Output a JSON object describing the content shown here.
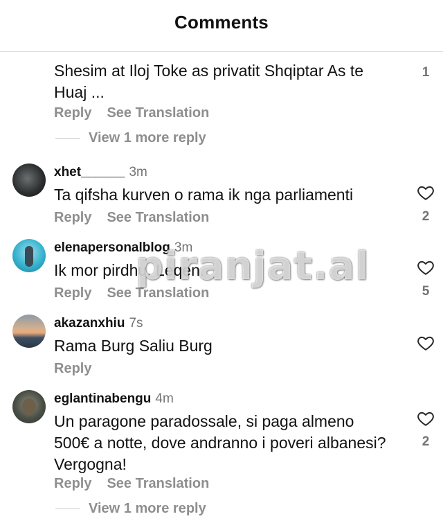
{
  "header": {
    "title": "Comments"
  },
  "top_comment": {
    "text": "Shesim at Iloj Toke as privatit Shqiptar As te Huaj ...",
    "count": "1",
    "reply_label": "Reply",
    "translate_label": "See Translation",
    "more_replies": "View 1 more reply"
  },
  "comments": [
    {
      "username": "xhet______",
      "time": "3m",
      "text": "Ta qifsha kurven o rama ik nga parliamenti",
      "likes": "2",
      "reply_label": "Reply",
      "translate_label": "See Translation"
    },
    {
      "username": "elenapersonalblog",
      "time": "3m",
      "text": "Ik mor pirdhu. Leqen.",
      "likes": "5",
      "reply_label": "Reply",
      "translate_label": "See Translation"
    },
    {
      "username": "akazanxhiu",
      "time": "7s",
      "text": "Rama Burg Saliu Burg",
      "likes": "",
      "reply_label": "Reply"
    },
    {
      "username": "eglantinabengu",
      "time": "4m",
      "text": "Un paragone paradossale, si paga almeno 500€ a notte, dove andranno i poveri albanesi? Vergogna!",
      "likes": "2",
      "reply_label": "Reply",
      "translate_label": "See Translation",
      "more_replies": "View 1 more reply"
    }
  ],
  "watermark": "piranjat.al",
  "icons": {
    "like": "heart-outline-icon"
  },
  "colors": {
    "text": "#111111",
    "secondary": "#8e8e8e",
    "time": "#737373"
  }
}
